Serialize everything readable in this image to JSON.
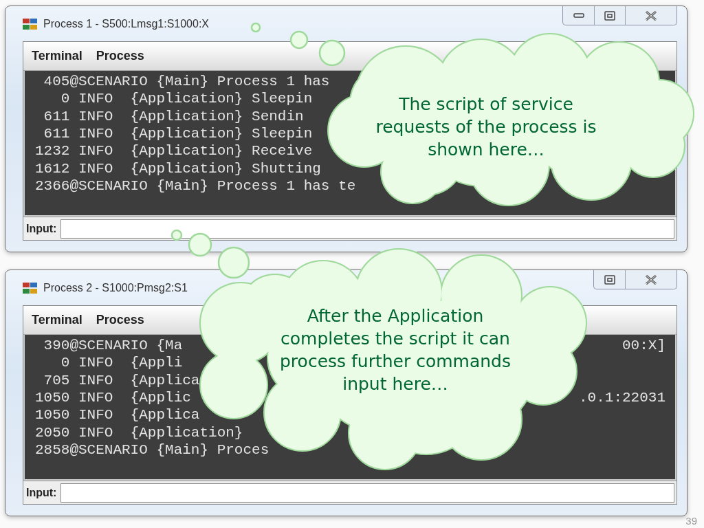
{
  "windows": [
    {
      "title": "Process 1 - S500:Lmsg1:S1000:X",
      "controls": [
        {
          "kind": "minimize"
        },
        {
          "kind": "maximize"
        },
        {
          "kind": "close"
        }
      ],
      "menu": [
        "Terminal",
        "Process"
      ],
      "lines": [
        {
          "text": " 405@SCENARIO {Main} Process 1 has"
        },
        {
          "text": "   0 INFO  {Application} Sleepin"
        },
        {
          "text": " 611 INFO  {Application} Sendin"
        },
        {
          "text": " 611 INFO  {Application} Sleepin"
        },
        {
          "text": "1232 INFO  {Application} Receive"
        },
        {
          "text": "1612 INFO  {Application} Shutting"
        },
        {
          "text": "2366@SCENARIO {Main} Process 1 has te"
        }
      ],
      "input_label": "Input:"
    },
    {
      "title": "Process 2 - S1000:Pmsg2:S1",
      "controls": [
        {
          "kind": "maximize"
        },
        {
          "kind": "close"
        }
      ],
      "menu": [
        "Terminal",
        "Process"
      ],
      "lines": [
        {
          "text": " 390@SCENARIO {Ma",
          "tail": "00:X]"
        },
        {
          "text": "   0 INFO  {Appli"
        },
        {
          "text": " 705 INFO  {Applica"
        },
        {
          "text": "1050 INFO  {Applic",
          "tail": ".0.1:22031"
        },
        {
          "text": "1050 INFO  {Applica"
        },
        {
          "text": "2050 INFO  {Application}"
        },
        {
          "text": "2858@SCENARIO {Main} Proces"
        }
      ],
      "input_label": "Input:"
    }
  ],
  "callouts": [
    {
      "text": "The script of service requests of the process is shown here…"
    },
    {
      "text": "After the Application completes the script it can process further commands input here…"
    }
  ],
  "page_number": "39"
}
